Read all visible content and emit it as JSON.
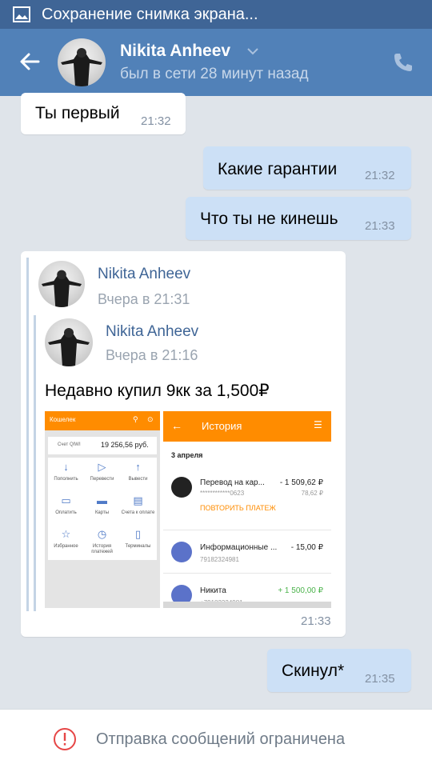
{
  "statusbar": {
    "text": "Сохранение снимка экрана..."
  },
  "header": {
    "contact_name": "Nikita Anheev",
    "last_seen": "был в сети 28 минут назад"
  },
  "messages": [
    {
      "direction": "in",
      "text": "Ты первый",
      "time": "21:32"
    },
    {
      "direction": "out",
      "text": "Какие гарантии",
      "time": "21:32"
    },
    {
      "direction": "out",
      "text": "Что ты не кинешь",
      "time": "21:33"
    },
    {
      "direction": "in",
      "time": "21:33",
      "forward": {
        "author": "Nikita Anheev",
        "date": "Вчера в 21:31",
        "nested": {
          "author": "Nikita Anheev",
          "date": "Вчера в 21:16",
          "text": "Недавно купил 9кк за 1,500₽"
        }
      }
    },
    {
      "direction": "out",
      "text": "Скинул*",
      "time": "21:35"
    }
  ],
  "wallet_screenshot": {
    "title": "Кошелек",
    "account_label": "Счет QIWI",
    "balance": "19 256,56 руб.",
    "actions": [
      "Пополнить",
      "Перевести",
      "Вывести",
      "Оплатить",
      "Карты",
      "Счета к оплате",
      "Избранное",
      "История платежей",
      "Терминалы"
    ]
  },
  "history_screenshot": {
    "title": "История",
    "date": "3 апреля",
    "items": [
      {
        "name": "Перевод на кар...",
        "sub": "************0623",
        "amount": "- 1 509,62 ₽",
        "fee": "78,62 ₽",
        "action": "ПОВТОРИТЬ ПЛАТЕЖ"
      },
      {
        "name": "Информационные ...",
        "sub": "79182324981",
        "amount": "- 15,00 ₽"
      },
      {
        "name": "Никита",
        "sub": "+79182324981",
        "amount": "+ 1 500,00 ₽"
      }
    ]
  },
  "footer": {
    "text": "Отправка сообщений ограничена"
  },
  "colors": {
    "header": "#5181b8",
    "statusbar": "#3f6596",
    "background": "#dfe4ea",
    "outgoing": "#cce0f6",
    "qiwi_orange": "#ff8c00",
    "positive": "#4bb34b",
    "warning": "#e64646"
  }
}
